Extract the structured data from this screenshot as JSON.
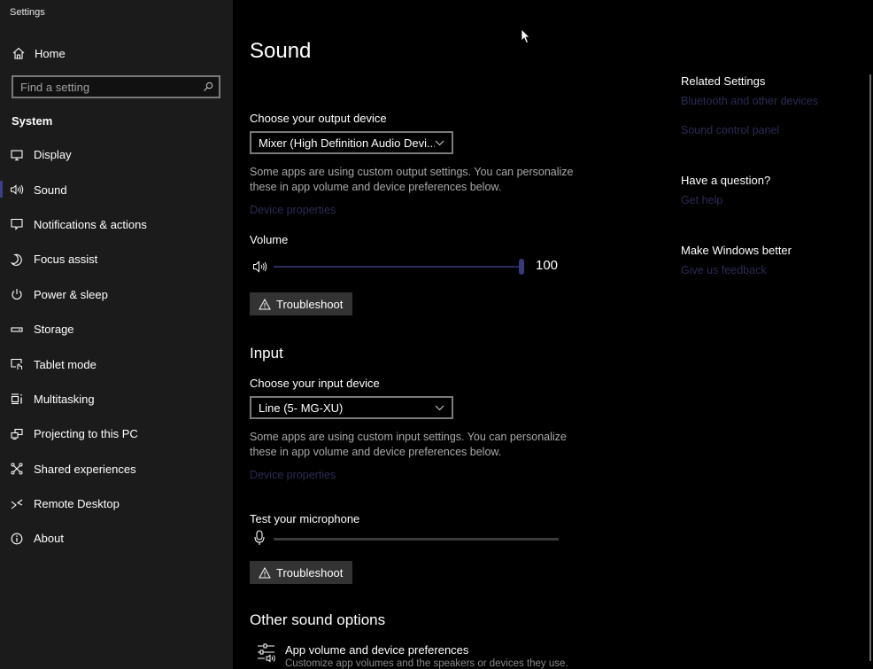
{
  "app": {
    "title": "Settings"
  },
  "sidebar": {
    "home_label": "Home",
    "search_placeholder": "Find a setting",
    "section_label": "System",
    "items": [
      {
        "label": "Display",
        "icon": "monitor-icon",
        "active": false
      },
      {
        "label": "Sound",
        "icon": "speaker-icon",
        "active": true
      },
      {
        "label": "Notifications & actions",
        "icon": "notification-icon",
        "active": false
      },
      {
        "label": "Focus assist",
        "icon": "moon-icon",
        "active": false
      },
      {
        "label": "Power & sleep",
        "icon": "power-icon",
        "active": false
      },
      {
        "label": "Storage",
        "icon": "storage-icon",
        "active": false
      },
      {
        "label": "Tablet mode",
        "icon": "tablet-mode-icon",
        "active": false
      },
      {
        "label": "Multitasking",
        "icon": "multitasking-icon",
        "active": false
      },
      {
        "label": "Projecting to this PC",
        "icon": "projecting-icon",
        "active": false
      },
      {
        "label": "Shared experiences",
        "icon": "shared-experiences-icon",
        "active": false
      },
      {
        "label": "Remote Desktop",
        "icon": "remote-desktop-icon",
        "active": false
      },
      {
        "label": "About",
        "icon": "info-icon",
        "active": false
      }
    ]
  },
  "main": {
    "title": "Sound",
    "output": {
      "label": "Choose your output device",
      "selected": "Mixer (High Definition Audio Devi...",
      "description": "Some apps are using custom output settings. You can personalize these in app volume and device preferences below.",
      "device_properties_link": "Device properties",
      "volume_label": "Volume",
      "volume_value": 100,
      "volume_display": "100",
      "troubleshoot_label": "Troubleshoot"
    },
    "input": {
      "heading": "Input",
      "label": "Choose your input device",
      "selected": "Line (5- MG-XU)",
      "description": "Some apps are using custom input settings. You can personalize these in app volume and device preferences below.",
      "device_properties_link": "Device properties",
      "test_mic_label": "Test your microphone",
      "mic_level": 0,
      "troubleshoot_label": "Troubleshoot"
    },
    "other": {
      "heading": "Other sound options",
      "app_volume_title": "App volume and device preferences",
      "app_volume_desc": "Customize app volumes and the speakers or devices they use."
    }
  },
  "related": {
    "heading": "Related Settings",
    "links": [
      "Bluetooth and other devices",
      "Sound control panel"
    ],
    "question_heading": "Have a question?",
    "get_help": "Get help",
    "better_heading": "Make Windows better",
    "feedback": "Give us feedback"
  },
  "colors": {
    "accent": "#363a7a",
    "link": "#2a2a55",
    "sidebar_bg": "#1b1b1b",
    "main_bg": "#000000"
  }
}
